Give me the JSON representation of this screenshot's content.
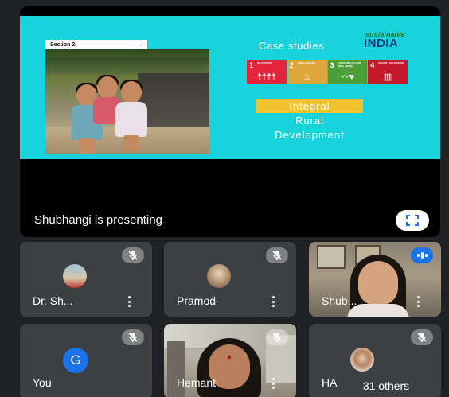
{
  "slide": {
    "section_label": "Section 2:",
    "section_arrow": "→",
    "logo_top": "sustainable",
    "logo_main": "INDIA",
    "title": "Case studies",
    "sdgs": [
      {
        "num": "1",
        "text": "NO POVERTY",
        "icon": "☨☨☨☨",
        "color": "#e5243b"
      },
      {
        "num": "2",
        "text": "ZERO HUNGER",
        "icon": "♨",
        "color": "#dda63a"
      },
      {
        "num": "3",
        "text": "GOOD HEALTH AND WELL-BEING",
        "icon": "〰♥",
        "color": "#4c9f38"
      },
      {
        "num": "4",
        "text": "QUALITY EDUCATION",
        "icon": "▥",
        "color": "#c5192d"
      }
    ],
    "line1": "Integral",
    "line2": "Rural",
    "line3": "Development"
  },
  "presenting": {
    "label": "Shubhangi is presenting"
  },
  "tiles": [
    {
      "name": "Dr. Sh...",
      "muted": true
    },
    {
      "name": "Pramod",
      "muted": true
    },
    {
      "name": "Shub...",
      "speaking": true
    },
    {
      "name": "You",
      "initial": "G",
      "muted": true
    },
    {
      "name": "Hemant",
      "muted": true
    },
    {
      "name": "HA",
      "muted": true
    }
  ],
  "others": {
    "label": "31 others"
  },
  "colors": {
    "slide_bg": "#19d3dc",
    "tile_bg": "#3c4043",
    "accent": "#1a73e8",
    "integral_box": "#f2c32c"
  }
}
